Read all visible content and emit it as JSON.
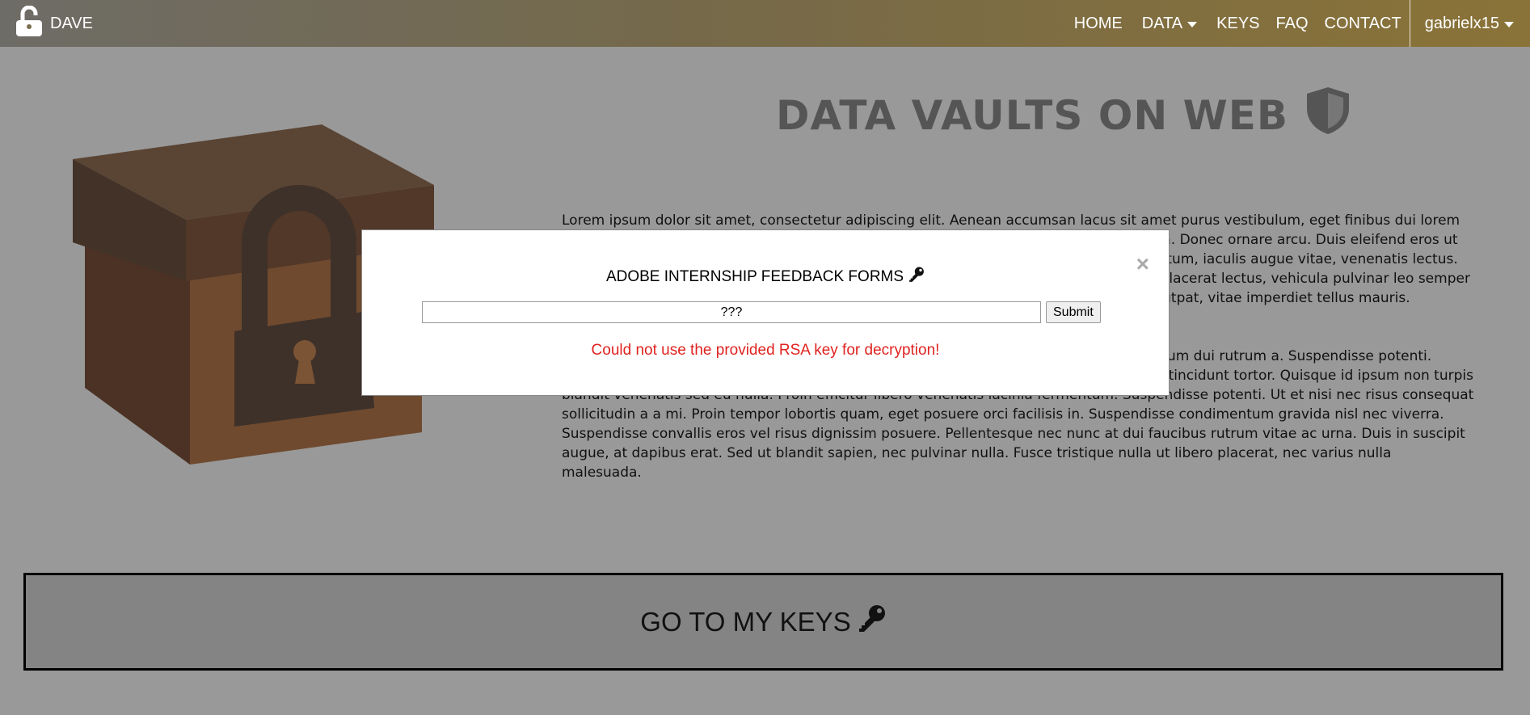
{
  "nav": {
    "brand": "DAVE",
    "brand_icon": "unlock-icon",
    "items": [
      "HOME",
      "DATA",
      "KEYS",
      "FAQ",
      "CONTACT"
    ],
    "user": "gabrielx15"
  },
  "hero": {
    "title": "DATA VAULTS ON WEB",
    "title_icon": "shield-icon",
    "illustration": "locked-box-icon",
    "paragraph1": "Lorem ipsum dolor sit amet, consectetur adipiscing elit. Aenean accumsan lacus sit amet purus vestibulum, eget finibus dui lorem ipsum dolor sit amet. Nunc varius quam vel aliquet fermentum, sed posuere nibh lacinia. Donec ornare arcu. Duis eleifend eros ut ligula consectetur, at viverra sem facilisis. Maecenas in odio quis diam molestie elementum, iaculis augue vitae, venenatis lectus. Nulla facilisi. Curabitur tempor metus at nisl tincidunt, id luctus erat placerat. Quisque placerat lectus, vehicula pulvinar leo semper nec. Phasellus quis mauris feugiat, pretium justo sit amet, tempor lectus. Fusce nisi volutpat, vitae imperdiet tellus mauris.",
    "paragraph2": "Integer a sapien non leo commodo facilisis. Donec vitae lorem eu lectus convallis interdum dui rutrum a. Suspendisse potenti. Curabitur bibendum, urna sed semper ultrices, purus quam lacinia nisl, sed elementum tincidunt tortor. Quisque id ipsum non turpis blandit venenatis sed eu nulla. Proin efficitur libero venenatis lacinia fermentum. Suspendisse potenti. Ut et nisi nec risus consequat sollicitudin a a mi. Proin tempor lobortis quam, eget posuere orci facilisis in. Suspendisse condimentum gravida nisl nec viverra. Suspendisse convallis eros vel risus dignissim posuere. Pellentesque nec nunc at dui faucibus rutrum vitae ac urna. Duis in suscipit augue, at dapibus erat. Sed ut blandit sapien, nec pulvinar nulla. Fusce tristique nulla ut libero placerat, nec varius nulla malesuada."
  },
  "keys_button": {
    "label": "GO TO MY KEYS",
    "icon": "key-icon"
  },
  "modal": {
    "title": "ADOBE INTERNSHIP FEEDBACK FORMS",
    "title_icon": "key-icon",
    "close": "×",
    "input_value": "???",
    "submit": "Submit",
    "error": "Could not use the provided RSA key for decryption!"
  },
  "colors": {
    "overlay_bg": "#999999",
    "error": "#e0231f",
    "title": "#555555"
  }
}
